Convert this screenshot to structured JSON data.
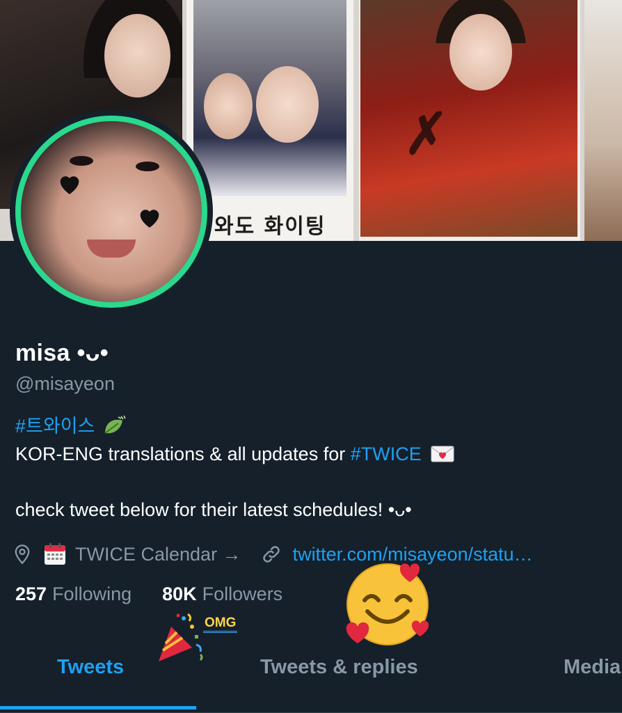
{
  "profile": {
    "name": "misa •ᴗ•",
    "handle": "@misayeon",
    "bio": {
      "hashtag_line": "#트와이스",
      "line2_text": "KOR-ENG translations & all updates for ",
      "line2_tag": "#TWICE",
      "line3": "check tweet below for their latest schedules! •ᴗ•"
    },
    "location": "TWICE Calendar →",
    "website": "twitter.com/misayeon/statu…",
    "following_count": "257",
    "following_label": "Following",
    "followers_count": "80K",
    "followers_label": "Followers"
  },
  "banner": {
    "caption": "와도 화이팅"
  },
  "stickers": {
    "omg": "OMG"
  },
  "tabs": [
    {
      "label": "Tweets",
      "active": true
    },
    {
      "label": "Tweets & replies",
      "active": false
    },
    {
      "label": "Media",
      "active": false
    }
  ],
  "colors": {
    "background": "#15202b",
    "accent": "#1da1f2",
    "muted": "#8899a6",
    "avatar_ring": "#2ad88e"
  },
  "icons": [
    "location-pin-icon",
    "calendar-icon",
    "link-icon",
    "leaf-icon",
    "envelope-heart-icon",
    "smiling-hearts-icon",
    "party-popper-icon"
  ]
}
